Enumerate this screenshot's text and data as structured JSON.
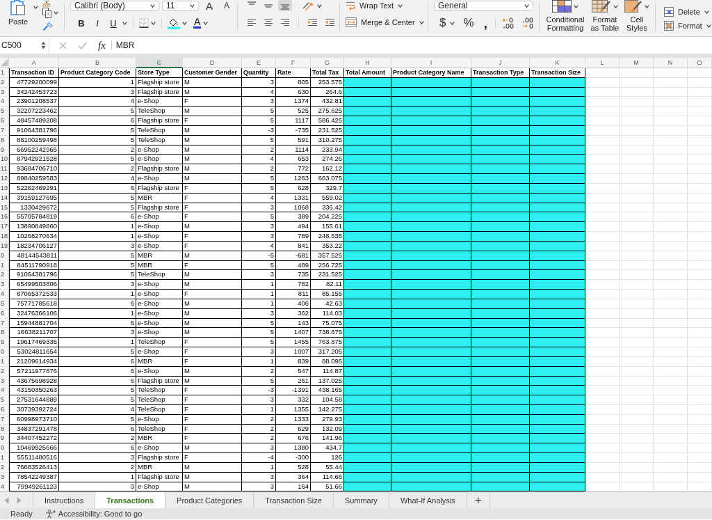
{
  "ribbon": {
    "clipboard": {
      "paste": "Paste"
    },
    "font": {
      "name": "Calibri (Body)",
      "size": "11",
      "grow": "A",
      "shrink": "A",
      "bold": "B",
      "italic": "I",
      "underline": "U",
      "font_color": "A"
    },
    "alignment": {
      "vertical_align": [
        {
          "kind": "top",
          "selected": false
        },
        {
          "kind": "middle",
          "selected": false
        },
        {
          "kind": "bottom",
          "selected": true
        }
      ],
      "wrap_text": "Wrap Text",
      "merge_center": "Merge & Center"
    },
    "number": {
      "format": "General",
      "currency": "$",
      "percent": "%",
      "comma": ","
    },
    "styles": {
      "conditional_formatting": "Conditional Formatting",
      "format_as_table": "Format as Table",
      "cell_styles": "Cell Styles"
    },
    "cells": {
      "delete": "Delete",
      "format": "Format"
    }
  },
  "formula_bar": {
    "name_box": "C500",
    "function_label": "fx",
    "content": "MBR"
  },
  "sheet": {
    "columns": [
      {
        "letter": "A",
        "selected": false,
        "heading": "Transaction ID",
        "kind": "number",
        "highlighted": false
      },
      {
        "letter": "B",
        "selected": false,
        "heading": "Product Category Code",
        "kind": "number",
        "highlighted": false
      },
      {
        "letter": "C",
        "selected": true,
        "heading": "Store Type",
        "kind": "text",
        "highlighted": false
      },
      {
        "letter": "D",
        "selected": false,
        "heading": "Customer Gender",
        "kind": "text",
        "highlighted": false
      },
      {
        "letter": "E",
        "selected": false,
        "heading": "Quantity",
        "kind": "number",
        "highlighted": false
      },
      {
        "letter": "F",
        "selected": false,
        "heading": "Rate",
        "kind": "number",
        "highlighted": false
      },
      {
        "letter": "G",
        "selected": false,
        "heading": "Total Tax",
        "kind": "number",
        "highlighted": false
      },
      {
        "letter": "H",
        "selected": false,
        "heading": "Total Amount",
        "highlighted": true
      },
      {
        "letter": "I",
        "selected": false,
        "heading": "Product Category Name",
        "highlighted": true
      },
      {
        "letter": "J",
        "selected": false,
        "heading": "Transaction Type",
        "highlighted": true
      },
      {
        "letter": "K",
        "selected": false,
        "heading": "Transaction Size",
        "highlighted": true
      },
      {
        "letter": "L",
        "selected": false
      },
      {
        "letter": "M",
        "selected": false
      },
      {
        "letter": "N",
        "selected": false
      },
      {
        "letter": "O",
        "selected": false
      }
    ],
    "header_row_number": "1",
    "rows": [
      {
        "number": "2",
        "cells": [
          "47729200099",
          "1",
          "Flagship store",
          "M",
          "3",
          "805",
          "253.575"
        ]
      },
      {
        "number": "3",
        "cells": [
          "34242453723",
          "3",
          "Flagship store",
          "M",
          "4",
          "630",
          "264.6"
        ]
      },
      {
        "number": "4",
        "cells": [
          "23901208537",
          "4",
          "e-Shop",
          "F",
          "3",
          "1374",
          "432.81"
        ]
      },
      {
        "number": "5",
        "cells": [
          "32207223462",
          "5",
          "TeleShop",
          "M",
          "5",
          "525",
          "275.625"
        ]
      },
      {
        "number": "6",
        "cells": [
          "48457489208",
          "6",
          "Flagship store",
          "F",
          "5",
          "1117",
          "586.425"
        ]
      },
      {
        "number": "7",
        "cells": [
          "91064381796",
          "5",
          "TeleShop",
          "M",
          "-3",
          "-735",
          "231.525"
        ]
      },
      {
        "number": "8",
        "cells": [
          "88100259498",
          "5",
          "TeleShop",
          "M",
          "5",
          "591",
          "310.275"
        ]
      },
      {
        "number": "9",
        "cells": [
          "66952242965",
          "2",
          "e-Shop",
          "M",
          "2",
          "1114",
          "233.94"
        ]
      },
      {
        "number": "10",
        "cells": [
          "87942921528",
          "5",
          "e-Shop",
          "M",
          "4",
          "653",
          "274.26"
        ]
      },
      {
        "number": "11",
        "cells": [
          "93684706710",
          "2",
          "Flagship store",
          "M",
          "2",
          "772",
          "162.12"
        ]
      },
      {
        "number": "12",
        "cells": [
          "89840259583",
          "4",
          "e-Shop",
          "M",
          "5",
          "1263",
          "663.075"
        ]
      },
      {
        "number": "13",
        "cells": [
          "52282469291",
          "6",
          "Flagship store",
          "F",
          "5",
          "628",
          "329.7"
        ]
      },
      {
        "number": "14",
        "cells": [
          "39159127695",
          "5",
          "MBR",
          "F",
          "4",
          "1331",
          "559.02"
        ]
      },
      {
        "number": "15",
        "cells": [
          "1330429672",
          "5",
          "Flagship store",
          "F",
          "3",
          "1068",
          "336.42"
        ]
      },
      {
        "number": "16",
        "cells": [
          "55705784819",
          "6",
          "e-Shop",
          "F",
          "5",
          "389",
          "204.225"
        ]
      },
      {
        "number": "17",
        "cells": [
          "13890849860",
          "1",
          "e-Shop",
          "M",
          "3",
          "494",
          "155.61"
        ]
      },
      {
        "number": "18",
        "cells": [
          "10268270634",
          "1",
          "e-Shop",
          "F",
          "3",
          "789",
          "248.535"
        ]
      },
      {
        "number": "19",
        "cells": [
          "18234706127",
          "3",
          "e-Shop",
          "F",
          "4",
          "841",
          "353.22"
        ]
      },
      {
        "number": "0",
        "cells": [
          "48144543811",
          "5",
          "MBR",
          "M",
          "-5",
          "-681",
          "357.525"
        ]
      },
      {
        "number": "1",
        "cells": [
          "84511790918",
          "5",
          "MBR",
          "F",
          "5",
          "489",
          "256.725"
        ]
      },
      {
        "number": "2",
        "cells": [
          "91064381796",
          "5",
          "TeleShop",
          "M",
          "3",
          "735",
          "231.525"
        ]
      },
      {
        "number": "3",
        "cells": [
          "65499503806",
          "3",
          "e-Shop",
          "M",
          "1",
          "782",
          "82.11"
        ]
      },
      {
        "number": "4",
        "cells": [
          "87065372533",
          "1",
          "e-Shop",
          "F",
          "1",
          "811",
          "85.155"
        ]
      },
      {
        "number": "5",
        "cells": [
          "75771785618",
          "6",
          "e-Shop",
          "M",
          "1",
          "406",
          "42.63"
        ]
      },
      {
        "number": "6",
        "cells": [
          "32476366106",
          "1",
          "e-Shop",
          "M",
          "3",
          "362",
          "114.03"
        ]
      },
      {
        "number": "7",
        "cells": [
          "15944881704",
          "6",
          "e-Shop",
          "M",
          "5",
          "143",
          "75.075"
        ]
      },
      {
        "number": "8",
        "cells": [
          "16638211707",
          "3",
          "e-Shop",
          "M",
          "5",
          "1407",
          "738.675"
        ]
      },
      {
        "number": "9",
        "cells": [
          "19617469335",
          "1",
          "TeleShop",
          "F",
          "5",
          "1455",
          "763.875"
        ]
      },
      {
        "number": "0",
        "cells": [
          "53024811654",
          "5",
          "e-Shop",
          "F",
          "3",
          "1007",
          "317.205"
        ]
      },
      {
        "number": "1",
        "cells": [
          "21209614934",
          "6",
          "MBR",
          "F",
          "1",
          "839",
          "88.095"
        ]
      },
      {
        "number": "2",
        "cells": [
          "57211977876",
          "6",
          "e-Shop",
          "M",
          "2",
          "547",
          "114.87"
        ]
      },
      {
        "number": "3",
        "cells": [
          "43675698928",
          "6",
          "Flagship store",
          "M",
          "5",
          "261",
          "137.025"
        ]
      },
      {
        "number": "4",
        "cells": [
          "43150350263",
          "5",
          "TeleShop",
          "F",
          "-3",
          "-1391",
          "438.165"
        ]
      },
      {
        "number": "5",
        "cells": [
          "27531644889",
          "5",
          "TeleShop",
          "F",
          "3",
          "332",
          "104.58"
        ]
      },
      {
        "number": "6",
        "cells": [
          "30739392724",
          "4",
          "TeleShop",
          "F",
          "1",
          "1355",
          "142.275"
        ]
      },
      {
        "number": "7",
        "cells": [
          "60998973710",
          "5",
          "e-Shop",
          "F",
          "2",
          "1333",
          "279.93"
        ]
      },
      {
        "number": "8",
        "cells": [
          "34837291478",
          "6",
          "TeleShop",
          "F",
          "2",
          "629",
          "132.09"
        ]
      },
      {
        "number": "9",
        "cells": [
          "34407452272",
          "2",
          "MBR",
          "F",
          "2",
          "676",
          "141.96"
        ]
      },
      {
        "number": "0",
        "cells": [
          "10469925666",
          "6",
          "e-Shop",
          "M",
          "3",
          "1380",
          "434.7"
        ]
      },
      {
        "number": "1",
        "cells": [
          "55511480516",
          "3",
          "Flagship store",
          "F",
          "-4",
          "-300",
          "126"
        ]
      },
      {
        "number": "2",
        "cells": [
          "76683526413",
          "2",
          "MBR",
          "M",
          "1",
          "528",
          "55.44"
        ]
      },
      {
        "number": "3",
        "cells": [
          "78542249387",
          "1",
          "Flagship store",
          "M",
          "3",
          "364",
          "114.66"
        ]
      },
      {
        "number": "4",
        "cells": [
          "79949261123",
          "3",
          "e-Shop",
          "M",
          "3",
          "164",
          "51.66"
        ]
      }
    ]
  },
  "sheet_tabs": {
    "tabs": [
      {
        "label": "Instructions",
        "selected": false
      },
      {
        "label": "Transactions",
        "selected": true
      },
      {
        "label": "Product Categories",
        "selected": false
      },
      {
        "label": "Transaction Size",
        "selected": false
      },
      {
        "label": "Summary",
        "selected": false
      },
      {
        "label": "What-If Analysis",
        "selected": false
      }
    ],
    "add_button": "+"
  },
  "status_bar": {
    "mode": "Ready",
    "accessibility": "Accessibility: Good to go"
  }
}
